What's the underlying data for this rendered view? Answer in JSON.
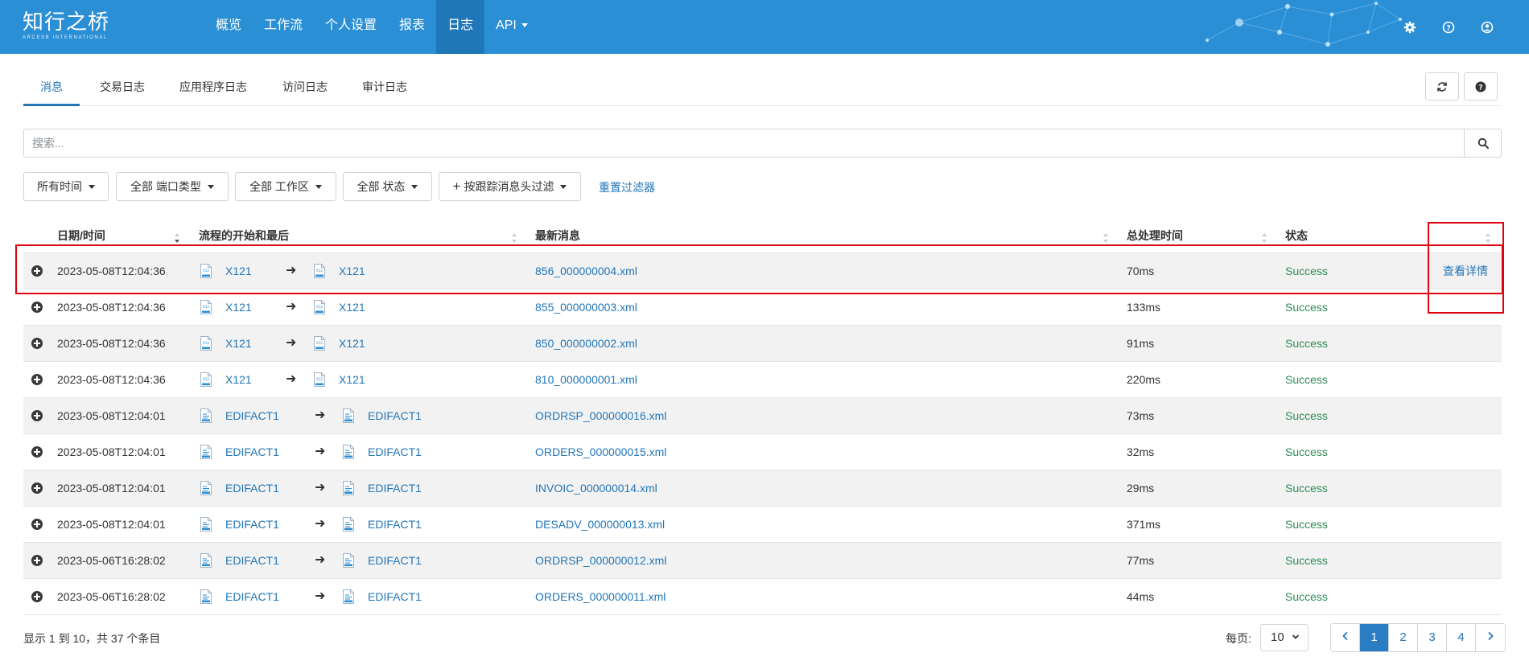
{
  "brand": {
    "name_cn": "知行之桥",
    "name_en": "ARCESB INTERNATIONAL"
  },
  "nav": {
    "items": [
      {
        "label": "概览",
        "active": false
      },
      {
        "label": "工作流",
        "active": false
      },
      {
        "label": "个人设置",
        "active": false
      },
      {
        "label": "报表",
        "active": false
      },
      {
        "label": "日志",
        "active": true
      },
      {
        "label": "API",
        "active": false,
        "dropdown": true
      }
    ],
    "icons": [
      "gear-icon",
      "help-icon",
      "user-icon"
    ]
  },
  "tabs": [
    {
      "label": "消息",
      "active": true
    },
    {
      "label": "交易日志",
      "active": false
    },
    {
      "label": "应用程序日志",
      "active": false
    },
    {
      "label": "访问日志",
      "active": false
    },
    {
      "label": "审计日志",
      "active": false
    }
  ],
  "search": {
    "placeholder": "搜索...",
    "value": ""
  },
  "filters": {
    "time": "所有时间",
    "port_type": "全部 端口类型",
    "workspace": "全部 工作区",
    "status": "全部 状态",
    "tracked_header": "按跟踪消息头过滤",
    "reset": "重置过滤器"
  },
  "table": {
    "headers": {
      "datetime": "日期/时间",
      "flow": "流程的开始和最后",
      "latest": "最新消息",
      "duration": "总处理时间",
      "status": "状态"
    },
    "view_details": "查看详情",
    "rows": [
      {
        "datetime": "2023-05-08T12:04:36",
        "from": "X121",
        "to": "X121",
        "file_type": "x12",
        "latest": "856_000000004.xml",
        "duration": "70ms",
        "status": "Success",
        "show_details": true
      },
      {
        "datetime": "2023-05-08T12:04:36",
        "from": "X121",
        "to": "X121",
        "file_type": "x12",
        "latest": "855_000000003.xml",
        "duration": "133ms",
        "status": "Success",
        "show_details": false
      },
      {
        "datetime": "2023-05-08T12:04:36",
        "from": "X121",
        "to": "X121",
        "file_type": "x12",
        "latest": "850_000000002.xml",
        "duration": "91ms",
        "status": "Success",
        "show_details": false
      },
      {
        "datetime": "2023-05-08T12:04:36",
        "from": "X121",
        "to": "X121",
        "file_type": "x12",
        "latest": "810_000000001.xml",
        "duration": "220ms",
        "status": "Success",
        "show_details": false
      },
      {
        "datetime": "2023-05-08T12:04:01",
        "from": "EDIFACT1",
        "to": "EDIFACT1",
        "file_type": "edifact",
        "latest": "ORDRSP_000000016.xml",
        "duration": "73ms",
        "status": "Success",
        "show_details": false
      },
      {
        "datetime": "2023-05-08T12:04:01",
        "from": "EDIFACT1",
        "to": "EDIFACT1",
        "file_type": "edifact",
        "latest": "ORDERS_000000015.xml",
        "duration": "32ms",
        "status": "Success",
        "show_details": false
      },
      {
        "datetime": "2023-05-08T12:04:01",
        "from": "EDIFACT1",
        "to": "EDIFACT1",
        "file_type": "edifact",
        "latest": "INVOIC_000000014.xml",
        "duration": "29ms",
        "status": "Success",
        "show_details": false
      },
      {
        "datetime": "2023-05-08T12:04:01",
        "from": "EDIFACT1",
        "to": "EDIFACT1",
        "file_type": "edifact",
        "latest": "DESADV_000000013.xml",
        "duration": "371ms",
        "status": "Success",
        "show_details": false
      },
      {
        "datetime": "2023-05-06T16:28:02",
        "from": "EDIFACT1",
        "to": "EDIFACT1",
        "file_type": "edifact",
        "latest": "ORDRSP_000000012.xml",
        "duration": "77ms",
        "status": "Success",
        "show_details": false
      },
      {
        "datetime": "2023-05-06T16:28:02",
        "from": "EDIFACT1",
        "to": "EDIFACT1",
        "file_type": "edifact",
        "latest": "ORDERS_000000011.xml",
        "duration": "44ms",
        "status": "Success",
        "show_details": false
      }
    ]
  },
  "footer": {
    "summary": "显示 1 到 10，共 37 个条目",
    "per_page_label": "每页:",
    "per_page_value": "10",
    "pages": [
      "1",
      "2",
      "3",
      "4"
    ],
    "current_page": "1"
  },
  "colors": {
    "navbar": "#2b8fd6",
    "nav_active": "#1f76b8",
    "link": "#2276b8",
    "success": "#2e8b57",
    "highlight": "#e0000f"
  }
}
